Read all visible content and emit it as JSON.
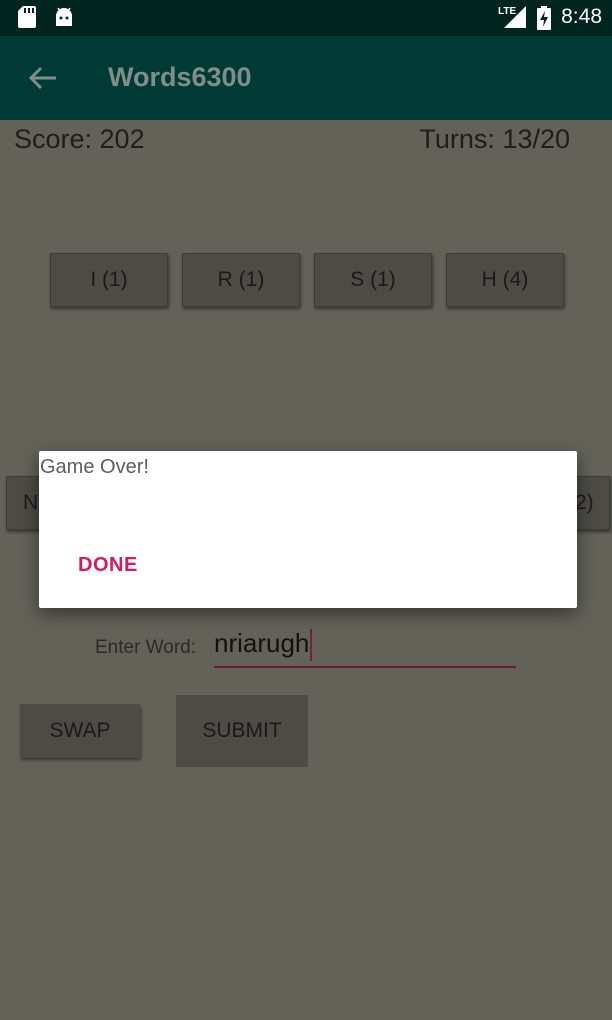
{
  "status_bar": {
    "time": "8:48",
    "network_label": "LTE",
    "icons": [
      "sd-card-icon",
      "android-icon",
      "signal-icon",
      "battery-charging-icon"
    ]
  },
  "app_bar": {
    "title": "Words6300",
    "back_icon": "arrow-back-icon"
  },
  "game": {
    "score": "Score: 202",
    "turns": "Turns: 13/20",
    "top_tiles": [
      "I (1)",
      "R (1)",
      "S (1)",
      "H (4)"
    ],
    "side_tile_left": "N",
    "side_tile_right": "2)",
    "enter_word_label": "Enter Word:",
    "word_value": "nriarugh",
    "swap_label": "SWAP",
    "submit_label": "SUBMIT"
  },
  "dialog": {
    "title": "Game Over!",
    "done_label": "DONE"
  },
  "colors": {
    "status_bar": "#00251f",
    "app_bar": "#003a34",
    "scrim_background": "#626259",
    "tile": "#4d4b45",
    "accent": "#d81b60"
  }
}
